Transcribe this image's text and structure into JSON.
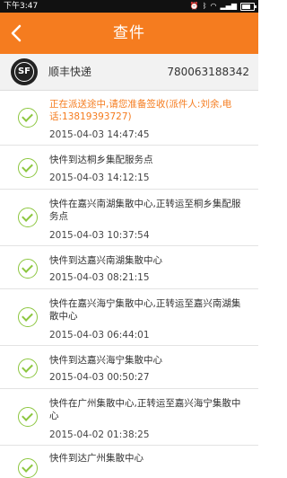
{
  "status_bar": {
    "time": "下午3:47"
  },
  "nav": {
    "title": "查件"
  },
  "courier": {
    "logo_text": "SF",
    "name": "顺丰快递",
    "tracking_number": "780063188342"
  },
  "events": [
    {
      "text": "正在派送途中,请您准备签收(派件人:刘余,电话:13819393727)",
      "time": "2015-04-03 14:47:45",
      "latest": true
    },
    {
      "text": "快件到达桐乡集配服务点",
      "time": "2015-04-03 14:12:15",
      "latest": false
    },
    {
      "text": "快件在嘉兴南湖集散中心,正转运至桐乡集配服务点",
      "time": "2015-04-03 10:37:54",
      "latest": false
    },
    {
      "text": "快件到达嘉兴南湖集散中心",
      "time": "2015-04-03 08:21:15",
      "latest": false
    },
    {
      "text": "快件在嘉兴海宁集散中心,正转运至嘉兴南湖集散中心",
      "time": "2015-04-03 06:44:01",
      "latest": false
    },
    {
      "text": "快件到达嘉兴海宁集散中心",
      "time": "2015-04-03 00:50:27",
      "latest": false
    },
    {
      "text": "快件在广州集散中心,正转运至嘉兴海宁集散中心",
      "time": "2015-04-02 01:38:25",
      "latest": false
    },
    {
      "text": "快件到达广州集散中心",
      "time": "",
      "latest": false
    }
  ]
}
